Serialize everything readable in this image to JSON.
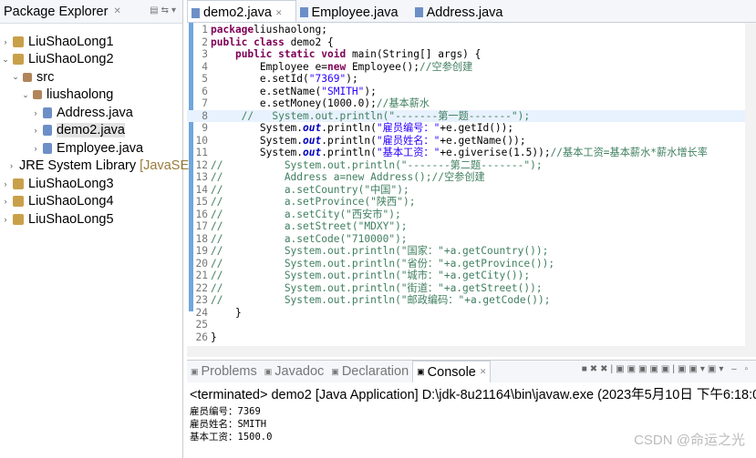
{
  "package_explorer": {
    "title": "Package Explorer",
    "tree": [
      {
        "label": "LiuShaoLong1",
        "level": 0,
        "expanded": false,
        "type": "project"
      },
      {
        "label": "LiuShaoLong2",
        "level": 0,
        "expanded": true,
        "type": "project"
      },
      {
        "label": "src",
        "level": 1,
        "expanded": true,
        "type": "src"
      },
      {
        "label": "liushaolong",
        "level": 2,
        "expanded": true,
        "type": "package"
      },
      {
        "label": "Address.java",
        "level": 3,
        "expanded": false,
        "type": "java"
      },
      {
        "label": "demo2.java",
        "level": 3,
        "expanded": false,
        "type": "java",
        "selected": true
      },
      {
        "label": "Employee.java",
        "level": 3,
        "expanded": false,
        "type": "java"
      },
      {
        "label": "JRE System Library",
        "suffix": "[JavaSE-",
        "level": 1,
        "expanded": false,
        "type": "library"
      },
      {
        "label": "LiuShaoLong3",
        "level": 0,
        "expanded": false,
        "type": "project"
      },
      {
        "label": "LiuShaoLong4",
        "level": 0,
        "expanded": false,
        "type": "project"
      },
      {
        "label": "LiuShaoLong5",
        "level": 0,
        "expanded": false,
        "type": "project"
      }
    ]
  },
  "editor": {
    "tabs": [
      {
        "label": "demo2.java",
        "active": true
      },
      {
        "label": "Employee.java"
      },
      {
        "label": "Address.java"
      }
    ],
    "highlighted_line": 8,
    "lines": [
      [
        [
          "kw",
          "package"
        ],
        [
          "",
          "liushaolong;"
        ]
      ],
      [
        [
          "kw",
          "public class"
        ],
        [
          "",
          " demo2 {"
        ]
      ],
      [
        [
          "",
          "    "
        ],
        [
          "kw",
          "public static void"
        ],
        [
          "",
          " main(String[] args) {"
        ]
      ],
      [
        [
          "",
          "        Employee e="
        ],
        [
          "kw",
          "new"
        ],
        [
          "",
          " Employee();"
        ],
        [
          "cm",
          "//空参创建"
        ]
      ],
      [
        [
          "",
          "        e.setId("
        ],
        [
          "str",
          "\"7369\""
        ],
        [
          "",
          ");"
        ]
      ],
      [
        [
          "",
          "        e.setName("
        ],
        [
          "str",
          "\"SMITH\""
        ],
        [
          "",
          ");"
        ]
      ],
      [
        [
          "",
          "        e.setMoney(1000.0);"
        ],
        [
          "cm",
          "//基本薪水"
        ]
      ],
      [
        [
          "cm",
          "     //   System.out.println(\"-------第一题-------\");"
        ]
      ],
      [
        [
          "",
          "        System."
        ],
        [
          "st",
          "out"
        ],
        [
          "",
          ".println("
        ],
        [
          "str",
          "\"雇员编号：\""
        ],
        [
          "",
          "+e.getId());"
        ]
      ],
      [
        [
          "",
          "        System."
        ],
        [
          "st",
          "out"
        ],
        [
          "",
          ".println("
        ],
        [
          "str",
          "\"雇员姓名：\""
        ],
        [
          "",
          "+e.getName());"
        ]
      ],
      [
        [
          "",
          "        System."
        ],
        [
          "st",
          "out"
        ],
        [
          "",
          ".println("
        ],
        [
          "str",
          "\"基本工资：\""
        ],
        [
          "",
          "+e.giverise(1.5));"
        ],
        [
          "cm",
          "//基本工资=基本薪水*薪水增长率"
        ]
      ],
      [
        [
          "cm",
          "//          System.out.println(\"-------第二题-------\");"
        ]
      ],
      [
        [
          "cm",
          "//          Address a=new Address();//空参创建"
        ]
      ],
      [
        [
          "cm",
          "//          a.setCountry(\"中国\");"
        ]
      ],
      [
        [
          "cm",
          "//          a.setProvince(\"陕西\");"
        ]
      ],
      [
        [
          "cm",
          "//          a.setCity(\"西安市\");"
        ]
      ],
      [
        [
          "cm",
          "//          a.setStreet(\"MDXY\");"
        ]
      ],
      [
        [
          "cm",
          "//          a.setCode(\"710000\");"
        ]
      ],
      [
        [
          "cm",
          "//          System.out.println(\"国家：\"+a.getCountry());"
        ]
      ],
      [
        [
          "cm",
          "//          System.out.println(\"省份：\"+a.getProvince());"
        ]
      ],
      [
        [
          "cm",
          "//          System.out.println(\"城市：\"+a.getCity());"
        ]
      ],
      [
        [
          "cm",
          "//          System.out.println(\"街道：\"+a.getStreet());"
        ]
      ],
      [
        [
          "cm",
          "//          System.out.println(\"邮政编码：\"+a.getCode());"
        ]
      ],
      [
        [
          "",
          "    }"
        ]
      ],
      [
        [
          "",
          ""
        ]
      ],
      [
        [
          "",
          "}"
        ]
      ]
    ]
  },
  "console": {
    "tabs": [
      {
        "label": "Problems"
      },
      {
        "label": "Javadoc"
      },
      {
        "label": "Declaration"
      },
      {
        "label": "Console",
        "active": true
      }
    ],
    "status": "<terminated> demo2 [Java Application] D:\\jdk-8u21164\\bin\\javaw.exe (2023年5月10日 下午6:18:02)",
    "output": [
      "雇员编号：7369",
      "雇员姓名：SMITH",
      "基本工资：1500.0"
    ]
  },
  "watermark": "CSDN @命运之光"
}
